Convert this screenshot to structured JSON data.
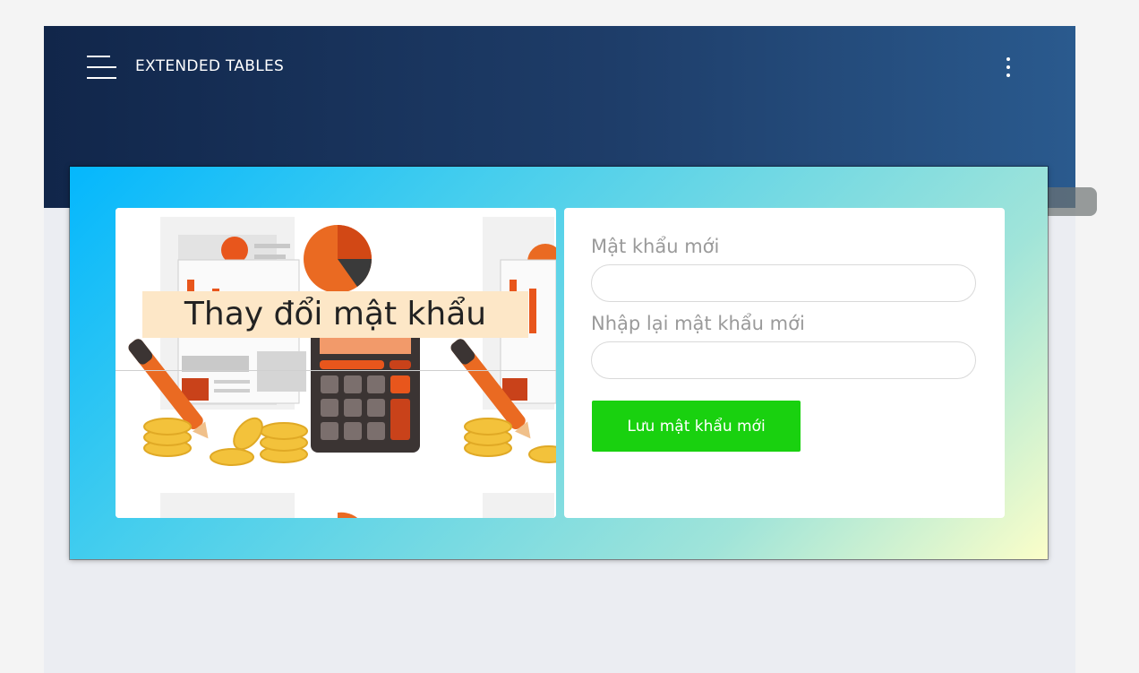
{
  "navbar": {
    "brand": "EXTENDED TABLES",
    "menu_icon": "hamburger-menu-icon",
    "more_icon": "vertical-dots-icon",
    "background_colors": [
      "#11264a",
      "#2a5a8e"
    ]
  },
  "card": {
    "gradient_colors": [
      "#04b7fd",
      "#43cdee",
      "#a0e4d9",
      "#fbfec9"
    ],
    "illustration": "accounting-calculator-illustration",
    "title": "Thay đổi mật khẩu"
  },
  "form": {
    "new_password_label": "Mật khẩu mới",
    "new_password_value": "",
    "confirm_password_label": "Nhập lại mật khẩu mới",
    "confirm_password_value": "",
    "save_button_label": "Lưu mật khẩu mới",
    "save_button_color": "#19d10f"
  }
}
